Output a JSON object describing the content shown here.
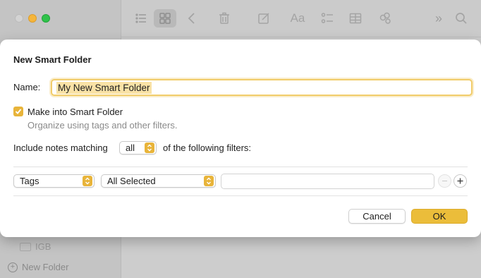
{
  "background": {
    "sidebar": {
      "item_label": "IGB",
      "new_folder_label": "New Folder"
    },
    "toolbar": {
      "icons": [
        "list-view-icon",
        "gallery-view-icon",
        "back-icon",
        "trash-icon",
        "compose-icon",
        "text-format-icon",
        "checklist-icon",
        "table-icon",
        "share-icon",
        "more-icon",
        "search-icon"
      ]
    }
  },
  "dialog": {
    "title": "New Smart Folder",
    "name_label": "Name:",
    "name_value": "My New Smart Folder",
    "checkbox_label": "Make into Smart Folder",
    "checkbox_checked": true,
    "checkbox_subtitle": "Organize using tags and other filters.",
    "match_prefix": "Include notes matching",
    "match_value": "all",
    "match_suffix": "of the following filters:",
    "filter": {
      "field": "Tags",
      "condition": "All Selected",
      "value": ""
    },
    "cancel_label": "Cancel",
    "ok_label": "OK"
  },
  "colors": {
    "accent": "#ebbd3a",
    "focus_ring": "#f1cc6a",
    "selection": "#f9e2a6"
  }
}
